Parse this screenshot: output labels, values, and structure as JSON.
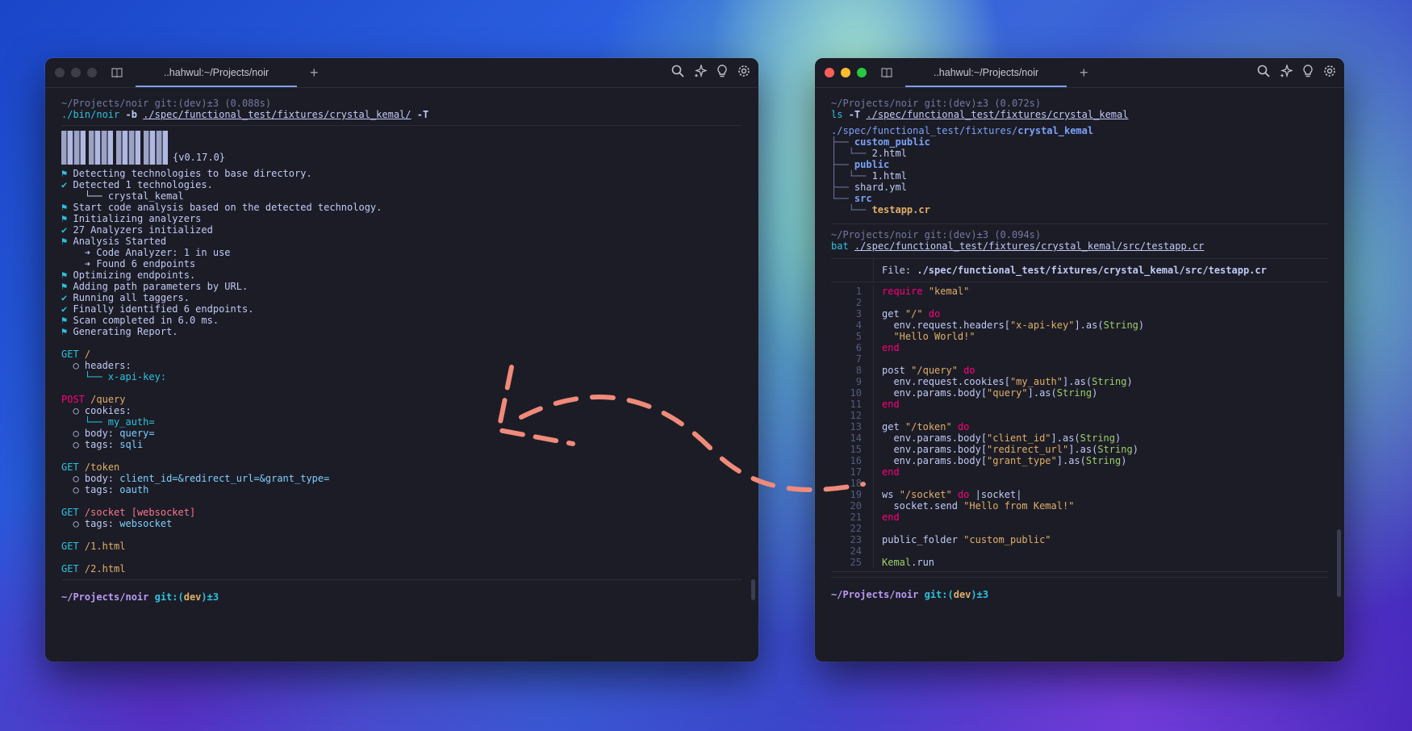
{
  "left_window": {
    "tab_title": "..hahwul:~/Projects/noir",
    "prompt": {
      "path": "~/Projects/noir",
      "git": "git:(dev)±3",
      "time": "(0.088s)",
      "cmd": "./bin/noir",
      "flag_b": "-b",
      "path_arg": "./spec/functional_test/fixtures/crystal_kemal/",
      "flag_T": "-T"
    },
    "version": "{v0.17.0}",
    "log": [
      {
        "sym": "⚑",
        "text": "Detecting technologies to base directory."
      },
      {
        "sym": "✔",
        "text": "Detected 1 technologies."
      },
      {
        "sym": " ",
        "text": "  └── crystal_kemal"
      },
      {
        "sym": "⚑",
        "text": "Start code analysis based on the detected technology."
      },
      {
        "sym": "⚑",
        "text": "Initializing analyzers"
      },
      {
        "sym": "✔",
        "text": "27 Analyzers initialized"
      },
      {
        "sym": "⚑",
        "text": "Analysis Started"
      },
      {
        "sym": " ",
        "text": "  ➔ Code Analyzer: 1 in use"
      },
      {
        "sym": " ",
        "text": "  ➔ Found 6 endpoints"
      },
      {
        "sym": "⚑",
        "text": "Optimizing endpoints."
      },
      {
        "sym": "⚑",
        "text": "Adding path parameters by URL."
      },
      {
        "sym": "✔",
        "text": "Running all taggers."
      },
      {
        "sym": "✔",
        "text": "Finally identified 6 endpoints."
      },
      {
        "sym": "⚑",
        "text": "Scan completed in 6.0 ms."
      },
      {
        "sym": "⚑",
        "text": "Generating Report."
      }
    ],
    "endpoints": {
      "e1_method": "GET",
      "e1_path": "/",
      "e1_headers": "headers:",
      "e1_header_item": "└── x-api-key:",
      "e2_method": "POST",
      "e2_path": "/query",
      "e2_cookies": "cookies:",
      "e2_cookie_item": "└── my_auth=",
      "e2_body_label": "body:",
      "e2_body_val": "query=",
      "e2_tags_label": "tags:",
      "e2_tags_val": "sqli",
      "e3_method": "GET",
      "e3_path": "/token",
      "e3_body_label": "body:",
      "e3_body_val": "client_id=&redirect_url=&grant_type=",
      "e3_tags_label": "tags:",
      "e3_tags_val": "oauth",
      "e4_method": "GET",
      "e4_path": "/socket [websocket]",
      "e4_tags_label": "tags:",
      "e4_tags_val": "websocket",
      "e5_method": "GET",
      "e5_path": "/1.html",
      "e6_method": "GET",
      "e6_path": "/2.html"
    },
    "bottom_prompt": {
      "path": "~/Projects/noir",
      "git_pre": "git:(",
      "branch": "dev",
      "git_post": ")±3"
    }
  },
  "right_window": {
    "tab_title": "..hahwul:~/Projects/noir",
    "prompt1": {
      "path": "~/Projects/noir",
      "git": "git:(dev)±3",
      "time": "(0.072s)",
      "cmd": "ls",
      "flag": "-T",
      "arg": "./spec/functional_test/fixtures/crystal_kemal"
    },
    "tree": {
      "root_prefix": "./spec/functional_test/fixtures/",
      "root_name": "crystal_kemal",
      "items": [
        {
          "prefix": "├── ",
          "name": "custom_public",
          "kind": "dir"
        },
        {
          "prefix": "│  └── ",
          "name": "2.html",
          "kind": "file"
        },
        {
          "prefix": "├── ",
          "name": "public",
          "kind": "dir"
        },
        {
          "prefix": "│  └── ",
          "name": "1.html",
          "kind": "file"
        },
        {
          "prefix": "├── ",
          "name": "shard.yml",
          "kind": "file"
        },
        {
          "prefix": "└── ",
          "name": "src",
          "kind": "dir"
        },
        {
          "prefix": "   └── ",
          "name": "testapp.cr",
          "kind": "cr"
        }
      ]
    },
    "prompt2": {
      "path": "~/Projects/noir",
      "git": "git:(dev)±3",
      "time": "(0.094s)",
      "cmd": "bat",
      "arg": "./spec/functional_test/fixtures/crystal_kemal/src/testapp.cr"
    },
    "file_label": "File:",
    "file_path": "./spec/functional_test/fixtures/crystal_kemal/src/testapp.cr",
    "line_numbers": [
      "1",
      "2",
      "3",
      "4",
      "5",
      "6",
      "7",
      "8",
      "9",
      "10",
      "11",
      "12",
      "13",
      "14",
      "15",
      "16",
      "17",
      "18",
      "19",
      "20",
      "21",
      "22",
      "23",
      "24",
      "25"
    ],
    "code": {
      "l1_kw": "require",
      "l1_str": "\"kemal\"",
      "l3_a": "get",
      "l3_str": "\"/\"",
      "l3_do": "do",
      "l4_a": "  env.request.headers[",
      "l4_str": "\"x-api-key\"",
      "l4_b": "].as(",
      "l4_type": "String",
      "l4_c": ")",
      "l5_str": "  \"Hello World!\"",
      "l6_end": "end",
      "l8_a": "post",
      "l8_str": "\"/query\"",
      "l8_do": "do",
      "l9_a": "  env.request.cookies[",
      "l9_str": "\"my_auth\"",
      "l9_b": "].as(",
      "l9_type": "String",
      "l9_c": ")",
      "l10_a": "  env.params.body[",
      "l10_str": "\"query\"",
      "l10_b": "].as(",
      "l10_type": "String",
      "l10_c": ")",
      "l11_end": "end",
      "l13_a": "get",
      "l13_str": "\"/token\"",
      "l13_do": "do",
      "l14_a": "  env.params.body[",
      "l14_str": "\"client_id\"",
      "l14_b": "].as(",
      "l14_type": "String",
      "l14_c": ")",
      "l15_a": "  env.params.body[",
      "l15_str": "\"redirect_url\"",
      "l15_b": "].as(",
      "l15_type": "String",
      "l15_c": ")",
      "l16_a": "  env.params.body[",
      "l16_str": "\"grant_type\"",
      "l16_b": "].as(",
      "l16_type": "String",
      "l16_c": ")",
      "l17_end": "end",
      "l19_a": "ws",
      "l19_str": "\"/socket\"",
      "l19_do": "do",
      "l19_b": "|socket|",
      "l20_a": "  socket.send",
      "l20_str": "\"Hello from Kemal!\"",
      "l21_end": "end",
      "l23_a": "public_folder",
      "l23_str": "\"custom_public\"",
      "l25_a": "Kemal",
      "l25_b": ".run"
    },
    "bottom_prompt": {
      "path": "~/Projects/noir",
      "git_pre": "git:(",
      "branch": "dev",
      "git_post": ")±3"
    }
  },
  "colors": {
    "accent": "#7aa2f7",
    "term_bg": "#1c1c26",
    "arrow": "#f08a7a"
  },
  "icons": [
    "search-icon",
    "sparkle-icon",
    "lightbulb-icon",
    "gear-icon",
    "book-icon",
    "plus-icon"
  ]
}
